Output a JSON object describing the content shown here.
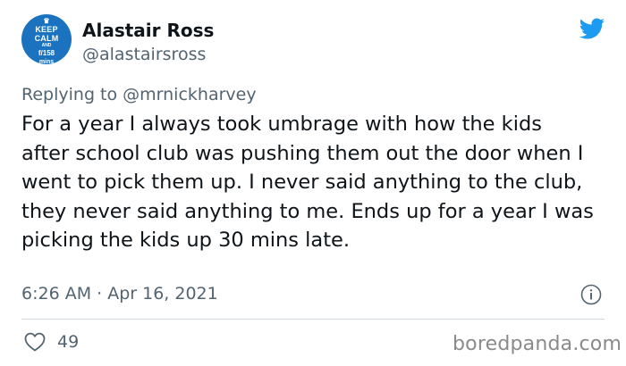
{
  "author": {
    "name": "Alastair Ross",
    "handle": "@alastairsross",
    "avatar_lines": [
      "KEEP",
      "CALM",
      "AND",
      "f/158",
      "mins"
    ]
  },
  "reply": {
    "prefix": "Replying to ",
    "mention": "@mrnickharvey"
  },
  "tweet": {
    "text": "For a year I always took umbrage with how the kids after school club was pushing them out the door when I went to pick them up.  I never said anything to the club, they never said anything to me.  Ends up for a year I was picking the kids up 30 mins late."
  },
  "meta": {
    "timestamp": "6:26 AM · Apr 16, 2021"
  },
  "stats": {
    "likes": "49"
  },
  "watermark": "boredpanda.com",
  "colors": {
    "twitter_blue": "#1d9bf0",
    "avatar_bg": "#1b73bf",
    "muted_text": "#536471"
  }
}
